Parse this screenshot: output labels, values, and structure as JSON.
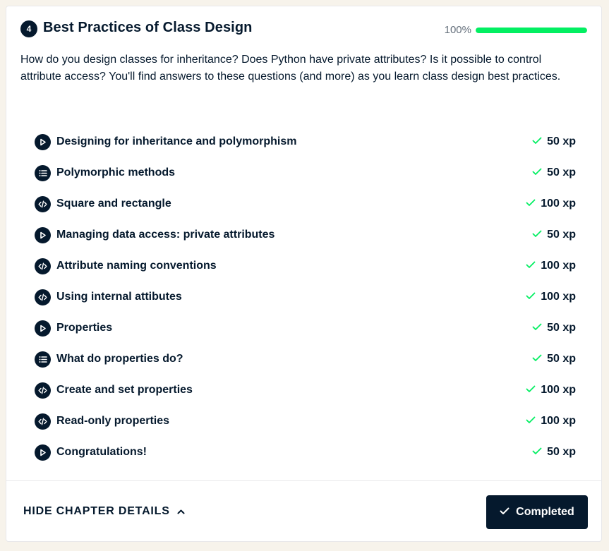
{
  "chapter": {
    "number": "4",
    "title": "Best Practices of Class Design",
    "progress_label": "100%",
    "progress_value": 1.0,
    "description": "How do you design classes for inheritance? Does Python have private attributes? Is it possible to control attribute access? You'll find answers to these questions (and more) as you learn class design best practices."
  },
  "exercises": [
    {
      "type": "video",
      "icon": "play-icon",
      "title": "Designing for inheritance and polymorphism",
      "xp": "50 xp",
      "completed": true
    },
    {
      "type": "multiple-choice",
      "icon": "list-icon",
      "title": "Polymorphic methods",
      "xp": "50 xp",
      "completed": true
    },
    {
      "type": "coding",
      "icon": "code-icon",
      "title": "Square and rectangle",
      "xp": "100 xp",
      "completed": true
    },
    {
      "type": "video",
      "icon": "play-icon",
      "title": "Managing data access: private attributes",
      "xp": "50 xp",
      "completed": true
    },
    {
      "type": "coding",
      "icon": "code-icon",
      "title": "Attribute naming conventions",
      "xp": "100 xp",
      "completed": true
    },
    {
      "type": "coding",
      "icon": "code-icon",
      "title": "Using internal attibutes",
      "xp": "100 xp",
      "completed": true
    },
    {
      "type": "video",
      "icon": "play-icon",
      "title": "Properties",
      "xp": "50 xp",
      "completed": true
    },
    {
      "type": "multiple-choice",
      "icon": "list-icon",
      "title": "What do properties do?",
      "xp": "50 xp",
      "completed": true
    },
    {
      "type": "coding",
      "icon": "code-icon",
      "title": "Create and set properties",
      "xp": "100 xp",
      "completed": true
    },
    {
      "type": "coding",
      "icon": "code-icon",
      "title": "Read-only properties",
      "xp": "100 xp",
      "completed": true
    },
    {
      "type": "video",
      "icon": "play-icon",
      "title": "Congratulations!",
      "xp": "50 xp",
      "completed": true
    }
  ],
  "footer": {
    "hide_details_label": "HIDE CHAPTER DETAILS",
    "completed_label": "Completed"
  },
  "colors": {
    "navy": "#05192d",
    "progress_green": "#03ef62",
    "check_green": "#03ef62",
    "background": "#f7f3eb"
  }
}
